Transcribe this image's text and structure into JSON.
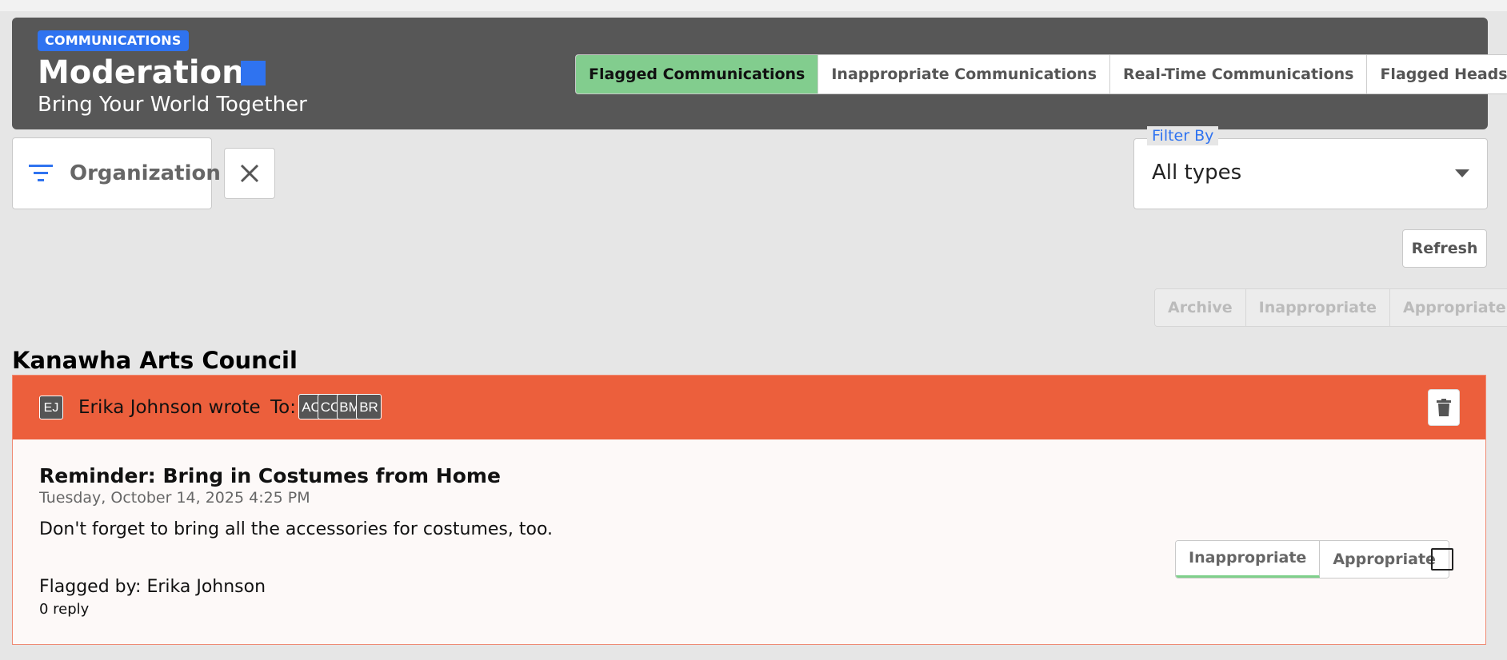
{
  "header": {
    "section_badge": "COMMUNICATIONS",
    "title": "Moderation",
    "subtitle": "Bring Your World Together",
    "accent_color": "#2f73f0",
    "tabs": [
      {
        "label": "Flagged Communications",
        "active": true
      },
      {
        "label": "Inappropriate Communications",
        "active": false
      },
      {
        "label": "Real-Time Communications",
        "active": false
      },
      {
        "label": "Flagged Headshots",
        "active": false
      }
    ]
  },
  "filters": {
    "organization_label": "Organization",
    "organization_icon": "filter-icon",
    "clear_icon": "close-icon",
    "filter_by_label": "Filter By",
    "filter_by_value": "All types"
  },
  "toolbar": {
    "refresh_label": "Refresh",
    "bulk_actions": [
      "Archive",
      "Inappropriate",
      "Appropriate"
    ]
  },
  "groups": [
    {
      "name": "Kanawha Arts Council",
      "messages": [
        {
          "author_initials": "EJ",
          "author_line": "Erika Johnson wrote",
          "to_label": "To:",
          "recipients": [
            "AC",
            "CC",
            "BM",
            "BR"
          ],
          "subject": "Reminder: Bring in Costumes from Home",
          "date": "Tuesday, October 14, 2025 4:25 PM",
          "body": "Don't forget to bring all the accessories for costumes, too.",
          "flagged_by": "Flagged by: Erika Johnson",
          "replies": "0 reply",
          "actions": [
            "Inappropriate",
            "Appropriate"
          ],
          "selected_action": "Inappropriate",
          "checked": false,
          "header_color": "#ec5f3c",
          "delete_icon": "trash-icon"
        }
      ]
    }
  ]
}
